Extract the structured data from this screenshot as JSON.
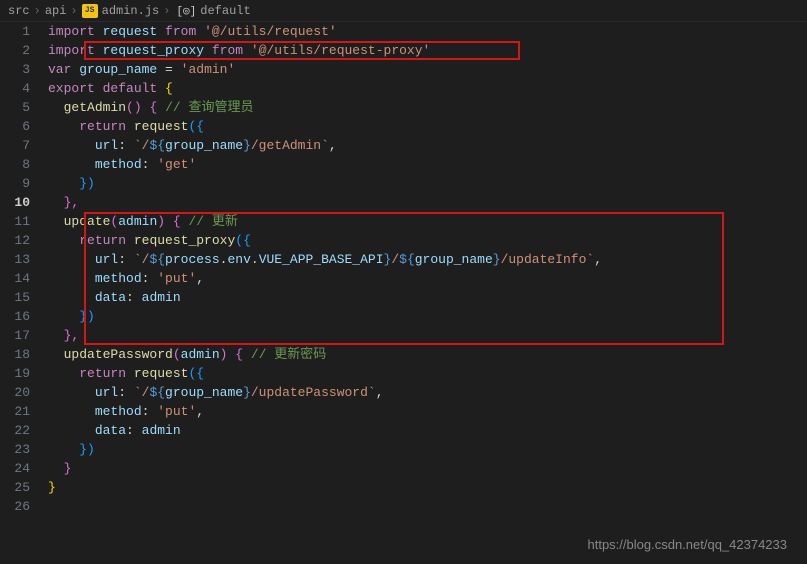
{
  "breadcrumb": {
    "folder1": "src",
    "folder2": "api",
    "file": "admin.js",
    "fileBadge": "JS",
    "symbol": "default"
  },
  "code": {
    "l1": {
      "kw1": "import",
      "id": "request",
      "kw2": "from",
      "str": "'@/utils/request'"
    },
    "l2": {
      "kw1": "import",
      "id": "request_proxy",
      "kw2": "from",
      "str": "'@/utils/request-proxy'"
    },
    "l3": {
      "kw1": "var",
      "id": "group_name",
      "eq": "=",
      "str": "'admin'"
    },
    "l4": {
      "kw1": "export",
      "kw2": "default",
      "brace": "{"
    },
    "l5": {
      "fn": "getAdmin",
      "par": "()",
      "brace": "{",
      "cmt": "// 查询管理员"
    },
    "l6": {
      "kw": "return",
      "fn": "request",
      "par": "({"
    },
    "l7": {
      "key": "url",
      "colon": ": ",
      "t1": "`/",
      "d1": "${",
      "v1": "group_name",
      "d2": "}",
      "t2": "/getAdmin`",
      "comma": ","
    },
    "l8": {
      "key": "method",
      "colon": ": ",
      "str": "'get'"
    },
    "l9": {
      "close": "})"
    },
    "l10": {
      "close": "},"
    },
    "l11": {
      "fn": "update",
      "par": "(",
      "arg": "admin",
      "par2": ")",
      "brace": "{",
      "cmt": "// 更新"
    },
    "l12": {
      "kw": "return",
      "fn": "request_proxy",
      "par": "({"
    },
    "l13": {
      "key": "url",
      "colon": ": ",
      "t1": "`/",
      "d1": "${",
      "v1": "process",
      "dot1": ".",
      "v2": "env",
      "dot2": ".",
      "v3": "VUE_APP_BASE_API",
      "d2": "}",
      "t2": "/",
      "d3": "${",
      "v4": "group_name",
      "d4": "}",
      "t3": "/updateInfo`",
      "comma": ","
    },
    "l14": {
      "key": "method",
      "colon": ": ",
      "str": "'put'",
      "comma": ","
    },
    "l15": {
      "key": "data",
      "colon": ": ",
      "id": "admin"
    },
    "l16": {
      "close": "})"
    },
    "l17": {
      "close": "},"
    },
    "l18": {
      "fn": "updatePassword",
      "par": "(",
      "arg": "admin",
      "par2": ")",
      "brace": "{",
      "cmt": "// 更新密码"
    },
    "l19": {
      "kw": "return",
      "fn": "request",
      "par": "({"
    },
    "l20": {
      "key": "url",
      "colon": ": ",
      "t1": "`/",
      "d1": "${",
      "v1": "group_name",
      "d2": "}",
      "t2": "/updatePassword`",
      "comma": ","
    },
    "l21": {
      "key": "method",
      "colon": ": ",
      "str": "'put'",
      "comma": ","
    },
    "l22": {
      "key": "data",
      "colon": ": ",
      "id": "admin"
    },
    "l23": {
      "close": "})"
    },
    "l24": {
      "close": "}"
    },
    "l25": {
      "close": "}"
    }
  },
  "lineNumbers": [
    "1",
    "2",
    "3",
    "4",
    "5",
    "6",
    "7",
    "8",
    "9",
    "10",
    "11",
    "12",
    "13",
    "14",
    "15",
    "16",
    "17",
    "18",
    "19",
    "20",
    "21",
    "22",
    "23",
    "24",
    "25",
    "26"
  ],
  "watermark": "https://blog.csdn.net/qq_42374233"
}
